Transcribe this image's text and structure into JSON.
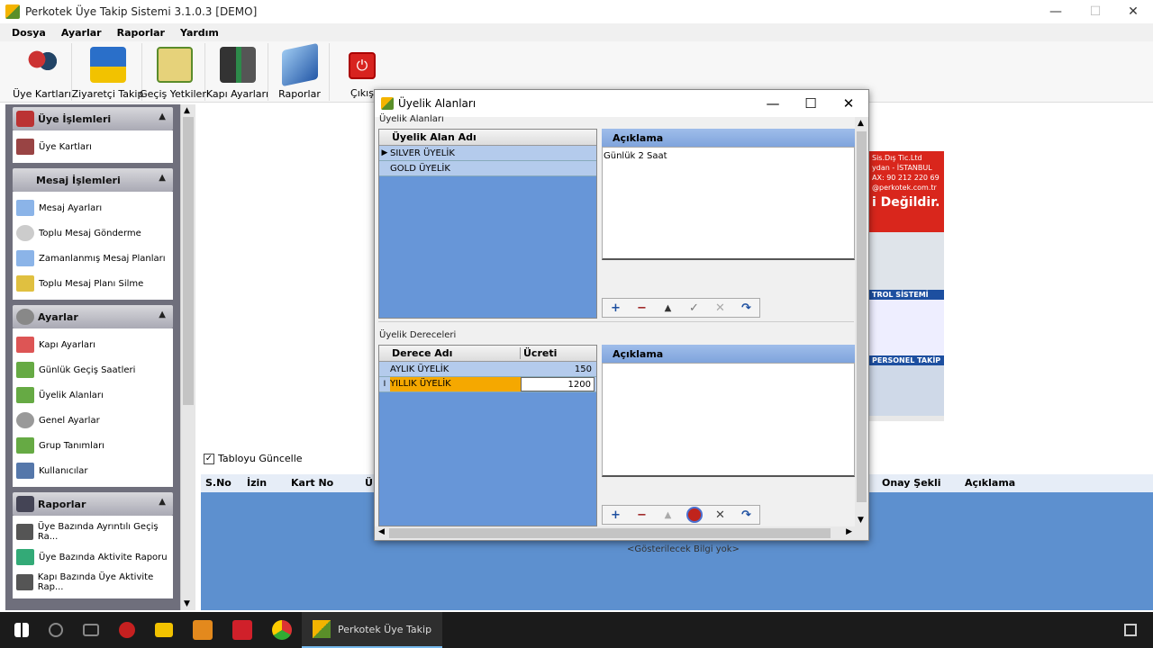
{
  "window": {
    "title": "Perkotek Üye Takip Sistemi 3.1.0.3 [DEMO]",
    "minimize": "—",
    "maximize": "☐",
    "close": "✕"
  },
  "menu": [
    "Dosya",
    "Ayarlar",
    "Raporlar",
    "Yardım"
  ],
  "toolbar": [
    {
      "label": "Üye Kartları",
      "icon": "members-icon"
    },
    {
      "label": "Ziyaretçi Takip",
      "icon": "visitor-icon"
    },
    {
      "label": "Geçiş Yetkileri",
      "icon": "checklist-icon"
    },
    {
      "label": "Kapı Ayarları",
      "icon": "door-icon"
    },
    {
      "label": "Raporlar",
      "icon": "book-icon"
    },
    {
      "label": "Çıkış",
      "icon": "power-icon"
    }
  ],
  "sidebar": {
    "groups": [
      {
        "title": "Üye İşlemleri",
        "items": [
          "Üye Kartları"
        ]
      },
      {
        "title": "Mesaj İşlemleri",
        "items": [
          "Mesaj Ayarları",
          "Toplu Mesaj Gönderme",
          "Zamanlanmış Mesaj Planları",
          "Toplu Mesaj Planı Silme"
        ]
      },
      {
        "title": "Ayarlar",
        "items": [
          "Kapı Ayarları",
          "Günlük Geçiş Saatleri",
          "Üyelik Alanları",
          "Genel Ayarlar",
          "Grup Tanımları",
          "Kullanıcılar"
        ]
      },
      {
        "title": "Raporlar",
        "items": [
          "Üye Bazında Ayrıntılı Geçiş Ra...",
          "Üye Bazında Aktivite Raporu",
          "Kapı Bazında Üye Aktivite Rap..."
        ]
      }
    ]
  },
  "main": {
    "refresh_label": "Tabloyu Güncelle",
    "columns": [
      "S.No",
      "İzin",
      "Kart No",
      "Ü",
      "Onay Şekli",
      "Açıklama"
    ],
    "no_data": "<Gösterilecek Bilgi yok>",
    "ad_text": [
      "Sis.Dış Tic.Ltd",
      "ydan - İSTANBUL",
      "AX: 90 212 220 69",
      "@perkotek.com.tr",
      "i Değildir.",
      "TROL SİSTEMİ",
      "PERSONEL TAKİP"
    ]
  },
  "dialog": {
    "title": "Üyelik Alanları",
    "section1": "Üyelik Alanları",
    "grid1": {
      "header": "Üyelik Alan Adı",
      "rows": [
        "SILVER ÜYELİK",
        "GOLD ÜYELİK"
      ],
      "selected": 0
    },
    "desc1": {
      "header": "Açıklama",
      "text": "Günlük 2 Saat"
    },
    "section2": "Üyelik Dereceleri",
    "grid2": {
      "headers": [
        "Derece Adı",
        "Ücreti"
      ],
      "rows": [
        [
          "AYLIK ÜYELİK",
          "150"
        ],
        [
          "YILLIK ÜYELİK",
          "1200"
        ]
      ],
      "editing": 1
    },
    "desc2": {
      "header": "Açıklama",
      "text": ""
    },
    "nav_buttons": [
      "+",
      "−",
      "▲",
      "✓",
      "✕",
      "↷"
    ]
  },
  "taskbar": {
    "app_label": "Perkotek Üye Takip"
  },
  "colors": {
    "grid_blue": "#6796d8",
    "selected_row": "#f5a800",
    "desc_header": "#8fb0e2"
  }
}
